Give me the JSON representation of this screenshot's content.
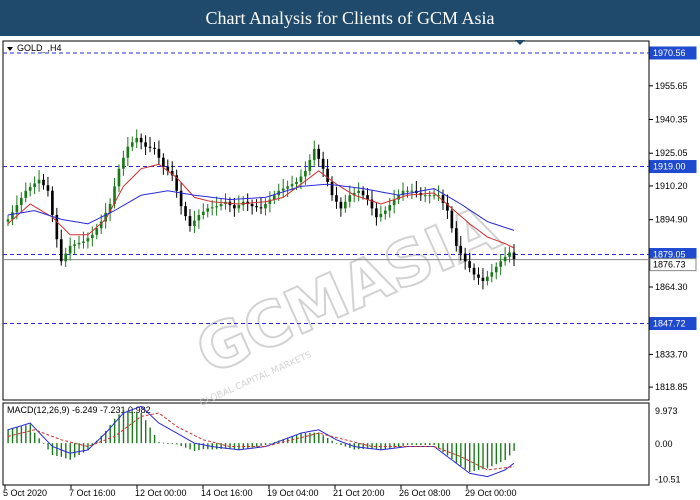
{
  "header": {
    "title": "Chart Analysis for Clients of GCM Asia"
  },
  "watermark": {
    "brand": "GCMASIA",
    "subtitle": "GLOBAL CAPITAL MARKETS"
  },
  "colors": {
    "title_bg": "#1f4a6b",
    "up_candle": "#1a7a1a",
    "down_candle": "#000000",
    "ma_fast": "#d03030",
    "ma_slow": "#2a2ad8",
    "level_line": "#2a2ad8",
    "price_tag_bg": "#1f4ad0",
    "macd_hist": "#1a7a1a",
    "macd_line": "#2a2ad8",
    "macd_signal": "#d03030"
  },
  "chart_data": [
    {
      "type": "candlestick",
      "symbol_label": "GOLD_,H4",
      "y_ticks": [
        "1970.56",
        "1955.65",
        "1940.35",
        "1925.05",
        "1910.20",
        "1894.90",
        "1864.30",
        "1833.70",
        "1818.85"
      ],
      "ylim": [
        1813,
        1976
      ],
      "grid": false,
      "levels": [
        {
          "value": 1970.56,
          "label": "1970.56"
        },
        {
          "value": 1919.0,
          "label": "1919.00"
        },
        {
          "value": 1879.05,
          "label": "1879.05"
        },
        {
          "value": 1847.72,
          "label": "1847.72"
        }
      ],
      "current_price": {
        "value": 1876.73,
        "label": "1876.73"
      },
      "x_tick_labels": [
        "5 Oct 2020",
        "7 Oct 16:00",
        "12 Oct 00:00",
        "14 Oct 16:00",
        "19 Oct 04:00",
        "21 Oct 20:00",
        "26 Oct 08:00",
        "29 Oct 00:00"
      ],
      "series": [
        {
          "name": "price",
          "anchors": [
            [
              0,
              1895
            ],
            [
              4,
              1908
            ],
            [
              7,
              1913
            ],
            [
              9,
              1908
            ],
            [
              11,
              1886
            ],
            [
              12,
              1876
            ],
            [
              14,
              1883
            ],
            [
              17,
              1885
            ],
            [
              19,
              1888
            ],
            [
              21,
              1894
            ],
            [
              23,
              1902
            ],
            [
              25,
              1918
            ],
            [
              27,
              1928
            ],
            [
              29,
              1932
            ],
            [
              31,
              1928
            ],
            [
              33,
              1927
            ],
            [
              35,
              1919
            ],
            [
              37,
              1915
            ],
            [
              39,
              1901
            ],
            [
              41,
              1892
            ],
            [
              43,
              1897
            ],
            [
              45,
              1900
            ],
            [
              47,
              1901
            ],
            [
              49,
              1903
            ],
            [
              51,
              1900
            ],
            [
              53,
              1903
            ],
            [
              55,
              1901
            ],
            [
              57,
              1900
            ],
            [
              59,
              1904
            ],
            [
              61,
              1908
            ],
            [
              63,
              1910
            ],
            [
              65,
              1912
            ],
            [
              67,
              1917
            ],
            [
              69,
              1927
            ],
            [
              71,
              1918
            ],
            [
              73,
              1906
            ],
            [
              75,
              1900
            ],
            [
              77,
              1906
            ],
            [
              79,
              1908
            ],
            [
              81,
              1904
            ],
            [
              83,
              1896
            ],
            [
              85,
              1899
            ],
            [
              87,
              1904
            ],
            [
              89,
              1908
            ],
            [
              91,
              1908
            ],
            [
              93,
              1906
            ],
            [
              95,
              1906
            ],
            [
              97,
              1906
            ],
            [
              99,
              1899
            ],
            [
              101,
              1883
            ],
            [
              103,
              1876
            ],
            [
              105,
              1870
            ],
            [
              107,
              1867
            ],
            [
              109,
              1871
            ],
            [
              111,
              1876
            ],
            [
              113,
              1880
            ],
            [
              114,
              1877
            ]
          ]
        },
        {
          "name": "MA fast",
          "anchors": [
            [
              0,
              1893
            ],
            [
              5,
              1902
            ],
            [
              10,
              1896
            ],
            [
              14,
              1888
            ],
            [
              18,
              1888
            ],
            [
              22,
              1895
            ],
            [
              26,
              1910
            ],
            [
              30,
              1918
            ],
            [
              34,
              1920
            ],
            [
              38,
              1914
            ],
            [
              42,
              1905
            ],
            [
              46,
              1903
            ],
            [
              52,
              1902
            ],
            [
              58,
              1903
            ],
            [
              62,
              1905
            ],
            [
              66,
              1911
            ],
            [
              70,
              1917
            ],
            [
              74,
              1911
            ],
            [
              78,
              1906
            ],
            [
              84,
              1902
            ],
            [
              90,
              1906
            ],
            [
              96,
              1907
            ],
            [
              100,
              1900
            ],
            [
              104,
              1893
            ],
            [
              108,
              1887
            ],
            [
              112,
              1884
            ],
            [
              114,
              1882
            ]
          ]
        },
        {
          "name": "MA slow",
          "anchors": [
            [
              0,
              1897
            ],
            [
              6,
              1899
            ],
            [
              12,
              1895
            ],
            [
              18,
              1893
            ],
            [
              24,
              1899
            ],
            [
              30,
              1906
            ],
            [
              36,
              1908
            ],
            [
              42,
              1906
            ],
            [
              50,
              1904
            ],
            [
              58,
              1905
            ],
            [
              66,
              1910
            ],
            [
              72,
              1911
            ],
            [
              80,
              1909
            ],
            [
              88,
              1906
            ],
            [
              96,
              1909
            ],
            [
              102,
              1902
            ],
            [
              108,
              1894
            ],
            [
              114,
              1890
            ]
          ]
        }
      ]
    },
    {
      "type": "line",
      "label": "MACD(12,26,9) -6.249 -7.231 0.982",
      "y_ticks": [
        "9.973",
        "0.00",
        "-10.51"
      ],
      "ylim": [
        -12.5,
        12.0
      ],
      "series": [
        {
          "name": "main",
          "anchors": [
            [
              0,
              4
            ],
            [
              5,
              6
            ],
            [
              10,
              -1
            ],
            [
              14,
              -3
            ],
            [
              18,
              -2
            ],
            [
              22,
              3
            ],
            [
              26,
              9
            ],
            [
              30,
              11
            ],
            [
              34,
              6
            ],
            [
              38,
              3
            ],
            [
              42,
              0
            ],
            [
              46,
              -1
            ],
            [
              52,
              -2
            ],
            [
              58,
              -1
            ],
            [
              62,
              1
            ],
            [
              66,
              3
            ],
            [
              70,
              4
            ],
            [
              74,
              1
            ],
            [
              78,
              -1
            ],
            [
              84,
              -2
            ],
            [
              90,
              -1
            ],
            [
              96,
              -1
            ],
            [
              100,
              -5
            ],
            [
              104,
              -9
            ],
            [
              108,
              -10
            ],
            [
              112,
              -8
            ],
            [
              114,
              -6
            ]
          ]
        },
        {
          "name": "signal",
          "anchors": [
            [
              0,
              2
            ],
            [
              6,
              4
            ],
            [
              12,
              1
            ],
            [
              18,
              -1
            ],
            [
              24,
              2
            ],
            [
              30,
              8
            ],
            [
              34,
              9
            ],
            [
              38,
              5
            ],
            [
              44,
              1
            ],
            [
              50,
              -1
            ],
            [
              58,
              -1
            ],
            [
              64,
              1
            ],
            [
              70,
              3
            ],
            [
              76,
              1
            ],
            [
              82,
              -1
            ],
            [
              90,
              -1
            ],
            [
              96,
              -1
            ],
            [
              102,
              -4
            ],
            [
              108,
              -8
            ],
            [
              114,
              -7
            ]
          ]
        }
      ]
    }
  ]
}
